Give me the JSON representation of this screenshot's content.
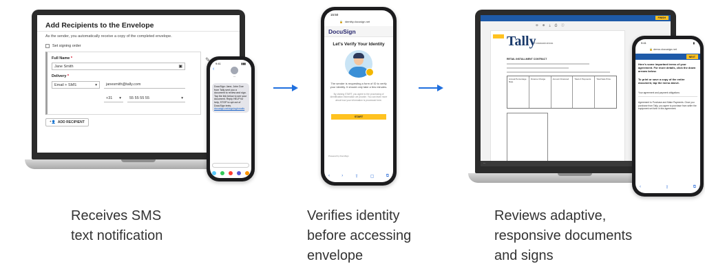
{
  "colors": {
    "arrow": "#1f6fde",
    "accent_yellow": "#ffc220",
    "docusign_navy": "#26266d",
    "tally_blue": "#1e5aa8"
  },
  "panel1": {
    "title": "Add Recipients to the Envelope",
    "subtitle": "As the sender, you automatically receive a copy of the completed envelope.",
    "signing_order_label": "Set signing order",
    "full_name_label": "Full Name",
    "full_name_value": "Jane Smith",
    "delivery_label": "Delivery",
    "delivery_method": "Email + SMS",
    "email_value": "janesmith@tally.com",
    "country_code": "+31",
    "phone_value": "55 55 55 55",
    "add_recipient_button": "ADD RECIPIENT",
    "sms": {
      "time": "9:41",
      "bubble_text": "DocuSign: Jane, John Doe from Tally sent you a document to review and sign. Tap the link below to see your document. Reply HELP for help, STOP to opt out of DocuSign texts.",
      "bubble_link": "docusign.net/signing/emails"
    }
  },
  "panel2": {
    "time": "15:50",
    "url": "identity.docusign.net",
    "brand": "DocuSign",
    "heading": "Let's Verify Your Identity",
    "body_text": "The sender is requesting a form of ID to verify your identity. It should only take a few minutes.",
    "small_text": "By clicking START, you agree to the processing of identification information we provide. You can learn more about how your information is processed here.",
    "start_button": "START",
    "footer_text": "Powered by DocuSign"
  },
  "panel3": {
    "finish_button": "FINISH",
    "logo": "Tally",
    "logo_sub": "Communications",
    "doc_heading": "RETAIL INSTALLMENT CONTRACT",
    "table_headers": [
      "Annual Percentage Rate",
      "Finance Charge",
      "Amount Financed",
      "Total of Payments",
      "Total Sale Price"
    ],
    "toolbar_icons": [
      "zoom-out-icon",
      "zoom-in-icon",
      "download-icon",
      "print-icon",
      "info-icon"
    ],
    "phone": {
      "time": "9:41",
      "url": "demo.docusign.net",
      "next_button": "NEXT",
      "intro_bold": "Here's some important terms of your agreement. For more details, click the down arrows below.",
      "print_bold": "To print or save a copy of the entire document, tap the menu above.",
      "section_title": "Your agreement and payment obligations",
      "section_text": "Agreement to Purchase and Make Payments. Once you purchase from Tally, you agree to purchase from seller the equipment set forth in this agreement."
    }
  },
  "captions": {
    "step1": [
      "Receives SMS",
      "text notification"
    ],
    "step2": [
      "Verifies identity",
      "before accessing",
      "envelope"
    ],
    "step3": [
      "Reviews adaptive,",
      "responsive documents",
      "and signs"
    ]
  }
}
